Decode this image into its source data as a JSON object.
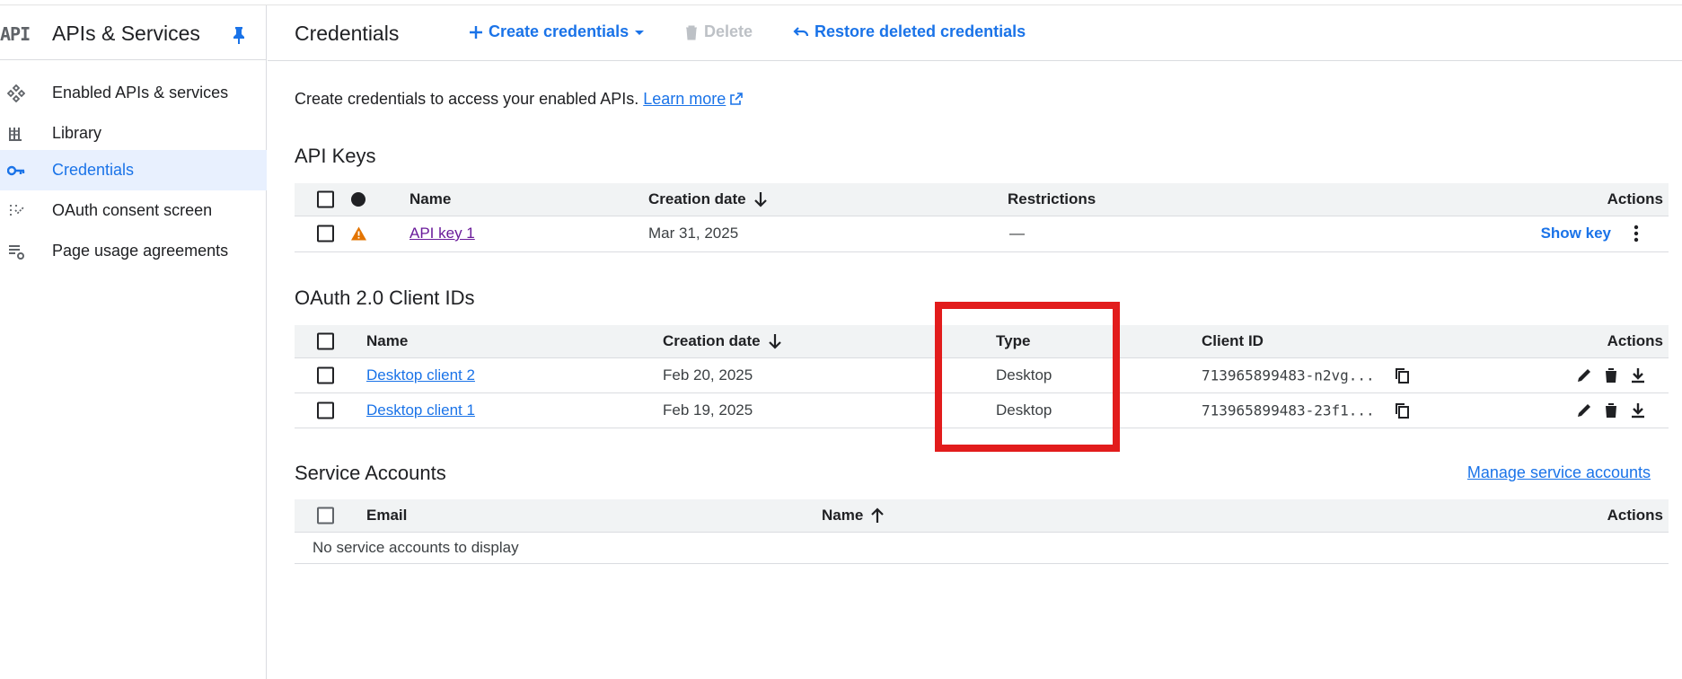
{
  "sidebar": {
    "logo": "API",
    "title": "APIs & Services",
    "items": [
      {
        "label": "Enabled APIs & services",
        "icon": "enabled-apis-icon"
      },
      {
        "label": "Library",
        "icon": "library-icon"
      },
      {
        "label": "Credentials",
        "icon": "key-icon",
        "active": true
      },
      {
        "label": "OAuth consent screen",
        "icon": "consent-icon"
      },
      {
        "label": "Page usage agreements",
        "icon": "agreements-icon"
      }
    ]
  },
  "header": {
    "title": "Credentials",
    "create_label": "Create credentials",
    "delete_label": "Delete",
    "restore_label": "Restore deleted credentials"
  },
  "intro": {
    "text": "Create credentials to access your enabled APIs.",
    "learn_more": "Learn more"
  },
  "api_keys": {
    "title": "API Keys",
    "headers": {
      "name": "Name",
      "created": "Creation date",
      "restrictions": "Restrictions",
      "actions": "Actions"
    },
    "rows": [
      {
        "name": "API key 1",
        "created": "Mar 31, 2025",
        "restrictions": "—",
        "action": "Show key"
      }
    ]
  },
  "oauth": {
    "title": "OAuth 2.0 Client IDs",
    "headers": {
      "name": "Name",
      "created": "Creation date",
      "type": "Type",
      "client_id": "Client ID",
      "actions": "Actions"
    },
    "rows": [
      {
        "name": "Desktop client 2",
        "created": "Feb 20, 2025",
        "type": "Desktop",
        "client_id": "713965899483-n2vg..."
      },
      {
        "name": "Desktop client 1",
        "created": "Feb 19, 2025",
        "type": "Desktop",
        "client_id": "713965899483-23f1..."
      }
    ]
  },
  "service_accounts": {
    "title": "Service Accounts",
    "manage_link": "Manage service accounts",
    "headers": {
      "email": "Email",
      "name": "Name",
      "actions": "Actions"
    },
    "empty": "No service accounts to display"
  },
  "colors": {
    "accent": "#1a73e8",
    "highlight": "#e21c1c",
    "warning": "#e37400"
  }
}
